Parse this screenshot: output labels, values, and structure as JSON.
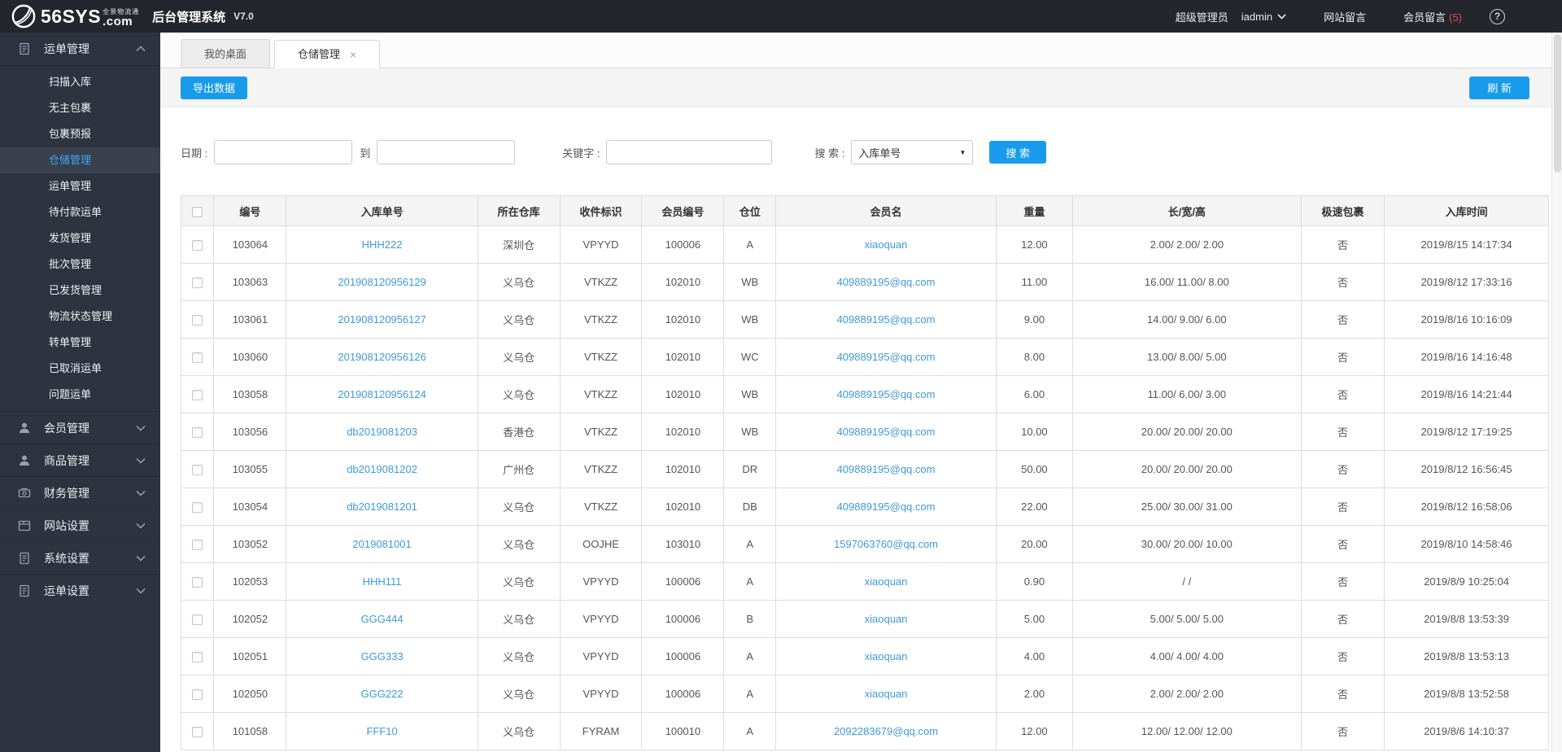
{
  "header": {
    "brand": "56SYS",
    "brand_dot_com": ".com",
    "brand_sub": "全景物流通",
    "app_title": "后台管理系统",
    "version": "V7.0",
    "role": "超级管理员",
    "username": "iadmin",
    "site_messages": "网站留言",
    "member_messages": "会员留言",
    "member_messages_count": "(5)"
  },
  "icons": {
    "help": "?",
    "tab_close": "×",
    "select_arrow": "▼"
  },
  "colors": {
    "accent_blue": "#199bec",
    "link_blue": "#3f9ad8",
    "active_menu_blue": "#3ea6f2",
    "alert_red": "#e14c4c",
    "topbar_bg": "#23262d",
    "sidebar_bg": "#2e3340"
  },
  "sidebar": {
    "groups": [
      {
        "label": "运单管理",
        "expanded": true,
        "items": [
          {
            "label": "扫描入库"
          },
          {
            "label": "无主包裹"
          },
          {
            "label": "包裹预报"
          },
          {
            "label": "仓储管理",
            "active": true
          },
          {
            "label": "运单管理"
          },
          {
            "label": "待付款运单"
          },
          {
            "label": "发货管理"
          },
          {
            "label": "批次管理"
          },
          {
            "label": "已发货管理"
          },
          {
            "label": "物流状态管理"
          },
          {
            "label": "转单管理"
          },
          {
            "label": "已取消运单"
          },
          {
            "label": "问题运单"
          }
        ]
      },
      {
        "label": "会员管理"
      },
      {
        "label": "商品管理"
      },
      {
        "label": "财务管理"
      },
      {
        "label": "网站设置"
      },
      {
        "label": "系统设置"
      },
      {
        "label": "运单设置"
      }
    ]
  },
  "tabs": [
    {
      "label": "我的桌面",
      "active": false,
      "closable": false
    },
    {
      "label": "仓储管理",
      "active": true,
      "closable": true
    }
  ],
  "toolbar": {
    "export_label": "导出数据",
    "refresh_label": "刷 新"
  },
  "filters": {
    "date_label": "日期 :",
    "to_label": "到",
    "keyword_label": "关键字 :",
    "search_label": "搜 索 :",
    "search_type_value": "入库单号",
    "search_button": "搜 索",
    "date_from_value": "",
    "date_to_value": "",
    "keyword_value": ""
  },
  "table": {
    "columns": [
      "编号",
      "入库单号",
      "所在仓库",
      "收件标识",
      "会员编号",
      "仓位",
      "会员名",
      "重量",
      "长/宽/高",
      "极速包裹",
      "入库时间"
    ],
    "rows": [
      [
        "103064",
        "HHH222",
        "深圳仓",
        "VPYYD",
        "100006",
        "A",
        "xiaoquan",
        "12.00",
        "2.00/ 2.00/ 2.00",
        "否",
        "2019/8/15 14:17:34"
      ],
      [
        "103063",
        "201908120956129",
        "义乌仓",
        "VTKZZ",
        "102010",
        "WB",
        "409889195@qq.com",
        "11.00",
        "16.00/ 11.00/ 8.00",
        "否",
        "2019/8/12 17:33:16"
      ],
      [
        "103061",
        "201908120956127",
        "义乌仓",
        "VTKZZ",
        "102010",
        "WB",
        "409889195@qq.com",
        "9.00",
        "14.00/ 9.00/ 6.00",
        "否",
        "2019/8/16 10:16:09"
      ],
      [
        "103060",
        "201908120956126",
        "义乌仓",
        "VTKZZ",
        "102010",
        "WC",
        "409889195@qq.com",
        "8.00",
        "13.00/ 8.00/ 5.00",
        "否",
        "2019/8/16 14:16:48"
      ],
      [
        "103058",
        "201908120956124",
        "义乌仓",
        "VTKZZ",
        "102010",
        "WB",
        "409889195@qq.com",
        "6.00",
        "11.00/ 6.00/ 3.00",
        "否",
        "2019/8/16 14:21:44"
      ],
      [
        "103056",
        "db2019081203",
        "香港仓",
        "VTKZZ",
        "102010",
        "WB",
        "409889195@qq.com",
        "10.00",
        "20.00/ 20.00/ 20.00",
        "否",
        "2019/8/12 17:19:25"
      ],
      [
        "103055",
        "db2019081202",
        "广州仓",
        "VTKZZ",
        "102010",
        "DR",
        "409889195@qq.com",
        "50.00",
        "20.00/ 20.00/ 20.00",
        "否",
        "2019/8/12 16:56:45"
      ],
      [
        "103054",
        "db2019081201",
        "义乌仓",
        "VTKZZ",
        "102010",
        "DB",
        "409889195@qq.com",
        "22.00",
        "25.00/ 30.00/ 31.00",
        "否",
        "2019/8/12 16:58:06"
      ],
      [
        "103052",
        "2019081001",
        "义乌仓",
        "OOJHE",
        "103010",
        "A",
        "1597063760@qq.com",
        "20.00",
        "30.00/ 20.00/ 10.00",
        "否",
        "2019/8/10 14:58:46"
      ],
      [
        "102053",
        "HHH111",
        "义乌仓",
        "VPYYD",
        "100006",
        "A",
        "xiaoquan",
        "0.90",
        "/ /",
        "否",
        "2019/8/9 10:25:04"
      ],
      [
        "102052",
        "GGG444",
        "义乌仓",
        "VPYYD",
        "100006",
        "B",
        "xiaoquan",
        "5.00",
        "5.00/ 5.00/ 5.00",
        "否",
        "2019/8/8 13:53:39"
      ],
      [
        "102051",
        "GGG333",
        "义乌仓",
        "VPYYD",
        "100006",
        "A",
        "xiaoquan",
        "4.00",
        "4.00/ 4.00/ 4.00",
        "否",
        "2019/8/8 13:53:13"
      ],
      [
        "102050",
        "GGG222",
        "义乌仓",
        "VPYYD",
        "100006",
        "A",
        "xiaoquan",
        "2.00",
        "2.00/ 2.00/ 2.00",
        "否",
        "2019/8/8 13:52:58"
      ],
      [
        "101058",
        "FFF10",
        "义乌仓",
        "FYRAM",
        "100010",
        "A",
        "2092283679@qq.com",
        "12.00",
        "12.00/ 12.00/ 12.00",
        "否",
        "2019/8/6 14:10:37"
      ]
    ]
  }
}
